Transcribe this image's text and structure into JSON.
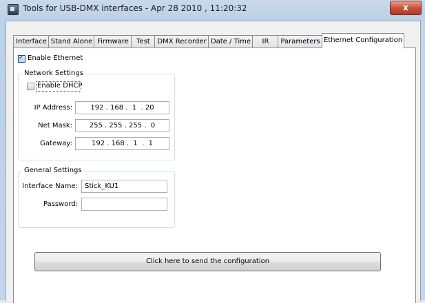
{
  "window": {
    "title": "Tools for USB-DMX interfaces - Apr 28 2010 , 11:20:32",
    "close_glyph": "x"
  },
  "tabs": [
    {
      "label": "Interface"
    },
    {
      "label": "Stand Alone"
    },
    {
      "label": "Firmware"
    },
    {
      "label": "Test"
    },
    {
      "label": "DMX Recorder"
    },
    {
      "label": "Date / Time"
    },
    {
      "label": "IR"
    },
    {
      "label": "Parameters"
    },
    {
      "label": "Ethernet Configuration",
      "active": true
    }
  ],
  "ethernet": {
    "enable_ethernet_label": "Enable Ethernet",
    "enable_ethernet_checked": true,
    "network": {
      "title": "Network Settings",
      "enable_dhcp_label": "Enable DHCP",
      "enable_dhcp_checked": false,
      "ip_label": "IP Address:",
      "ip_value": "192 . 168 .  1  . 20",
      "mask_label": "Net Mask:",
      "mask_value": "255 . 255 . 255 .  0",
      "gateway_label": "Gateway:",
      "gateway_value": "192 . 168 .  1  .  1"
    },
    "general": {
      "title": "General Settings",
      "name_label": "Interface Name:",
      "name_value": "Stick_KU1",
      "password_label": "Password:",
      "password_value": ""
    },
    "send_label": "Click here to send the configuration"
  }
}
